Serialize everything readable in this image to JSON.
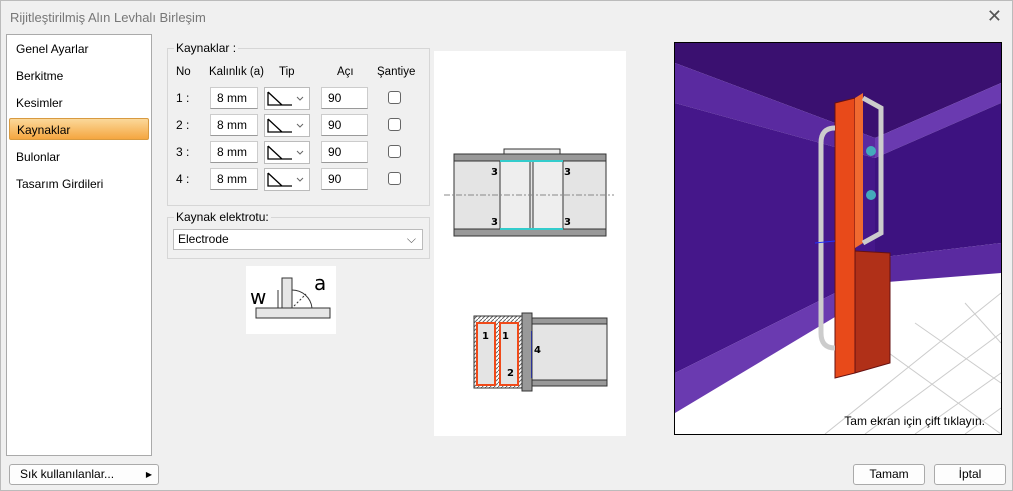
{
  "window": {
    "title": "Rijitleştirilmiş Alın Levhalı Birleşim"
  },
  "sidebar": {
    "items": [
      {
        "label": "Genel Ayarlar"
      },
      {
        "label": "Berkitme"
      },
      {
        "label": "Kesimler"
      },
      {
        "label": "Kaynaklar",
        "selected": true
      },
      {
        "label": "Bulonlar"
      },
      {
        "label": "Tasarım Girdileri"
      }
    ]
  },
  "welds": {
    "group_label": "Kaynaklar :",
    "headers": {
      "no": "No",
      "thickness": "Kalınlık (a)",
      "type": "Tip",
      "angle": "Açı",
      "site": "Şantiye"
    },
    "rows": [
      {
        "no": "1 :",
        "thickness": "8 mm",
        "type": "fillet-weld-icon",
        "angle": "90",
        "site": false
      },
      {
        "no": "2 :",
        "thickness": "8 mm",
        "type": "fillet-weld-icon",
        "angle": "90",
        "site": false
      },
      {
        "no": "3 :",
        "thickness": "8 mm",
        "type": "fillet-weld-icon",
        "angle": "90",
        "site": false
      },
      {
        "no": "4 :",
        "thickness": "8 mm",
        "type": "fillet-weld-icon",
        "angle": "90",
        "site": false
      }
    ]
  },
  "electrode": {
    "group_label": "Kaynak elektrotu:",
    "value": "Electrode"
  },
  "weld_symbol": {
    "w": "w",
    "a": "a"
  },
  "diagram": {
    "labels_top": [
      "3",
      "3",
      "3",
      "3"
    ],
    "labels_bottom": [
      "1",
      "1",
      "2",
      "4"
    ]
  },
  "view3d": {
    "hint": "Tam ekran için çift tıklayın.",
    "colors": {
      "beam": "#4a1a8c",
      "plate": "#f04a1a",
      "stiffener": "#b03018"
    }
  },
  "footer": {
    "favorites": "Sık kullanılanlar...",
    "ok": "Tamam",
    "cancel": "İptal"
  }
}
